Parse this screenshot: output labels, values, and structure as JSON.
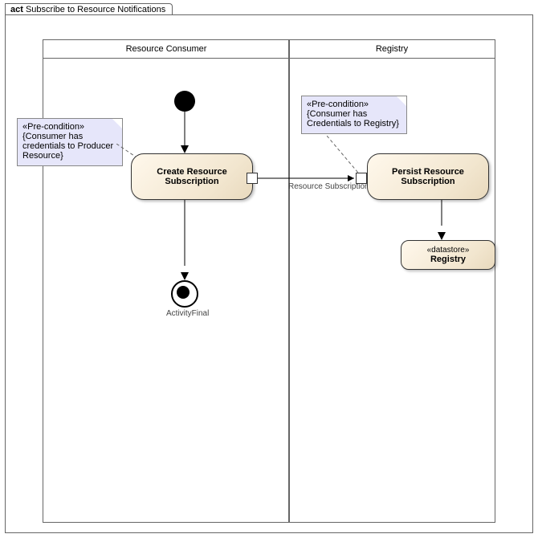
{
  "frame": {
    "keyword": "act",
    "title": "Subscribe to Resource Notifications"
  },
  "lanes": {
    "consumer": "Resource Consumer",
    "registry": "Registry"
  },
  "notes": {
    "consumer_pre": {
      "stereotype": "«Pre-condition»",
      "text": "{Consumer has credentials to Producer Resource}"
    },
    "registry_pre": {
      "stereotype": "«Pre-condition»",
      "text": "{Consumer has Credentials to Registry}"
    }
  },
  "activities": {
    "create_sub": "Create Resource Subscription",
    "persist_sub": "Persist Resource Subscription"
  },
  "datastore": {
    "stereotype": "«datastore»",
    "name": "Registry"
  },
  "edges": {
    "object_flow_label": "Resource Subscription",
    "final_label": "ActivityFinal"
  },
  "colors": {
    "note_bg": "#E6E6FA",
    "activity_bg": "#F2E6CF"
  }
}
